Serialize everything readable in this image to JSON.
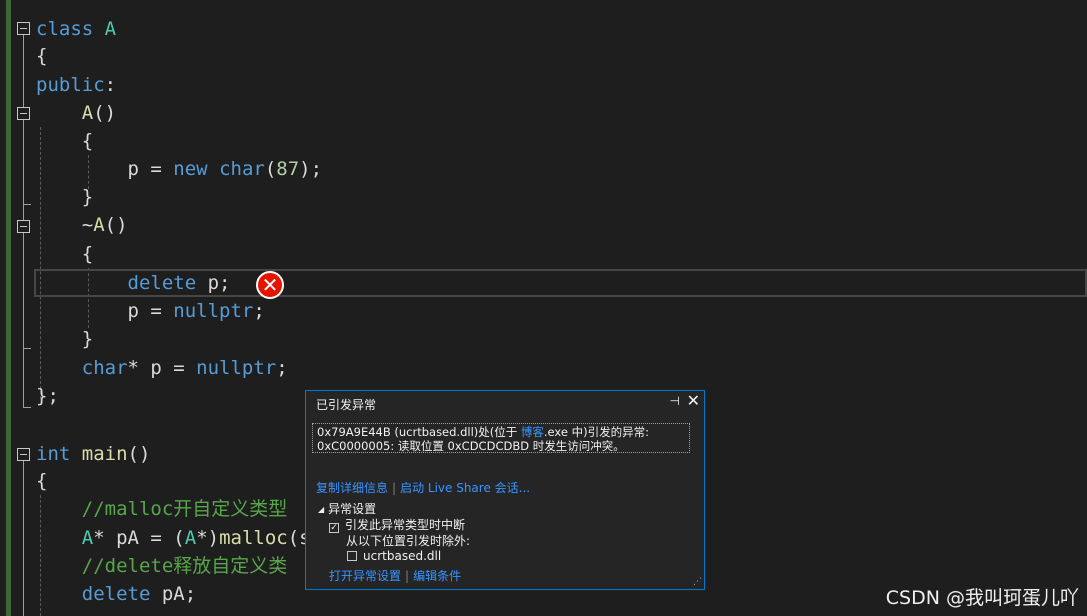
{
  "editor": {
    "lines": [
      {
        "id": "l1",
        "tokens": [
          [
            "kw",
            "class"
          ],
          [
            "id",
            " "
          ],
          [
            "cls",
            "A"
          ]
        ]
      },
      {
        "id": "l2",
        "tokens": [
          [
            "id",
            "{"
          ]
        ]
      },
      {
        "id": "l3",
        "tokens": [
          [
            "kw",
            "public"
          ],
          [
            "id",
            ":"
          ]
        ]
      },
      {
        "id": "l4",
        "tokens": [
          [
            "id",
            "    "
          ],
          [
            "fn",
            "A"
          ],
          [
            "id",
            "()"
          ]
        ]
      },
      {
        "id": "l5",
        "tokens": [
          [
            "id",
            "    {"
          ]
        ]
      },
      {
        "id": "l6",
        "tokens": [
          [
            "id",
            "        p = "
          ],
          [
            "kw",
            "new"
          ],
          [
            "id",
            " "
          ],
          [
            "kw",
            "char"
          ],
          [
            "id",
            "("
          ],
          [
            "num",
            "87"
          ],
          [
            "id",
            ");"
          ]
        ]
      },
      {
        "id": "l7",
        "tokens": [
          [
            "id",
            "    }"
          ]
        ]
      },
      {
        "id": "l8",
        "tokens": [
          [
            "id",
            "    ~"
          ],
          [
            "fn",
            "A"
          ],
          [
            "id",
            "()"
          ]
        ]
      },
      {
        "id": "l9",
        "tokens": [
          [
            "id",
            "    {"
          ]
        ]
      },
      {
        "id": "l10",
        "tokens": [
          [
            "id",
            "        "
          ],
          [
            "kw",
            "delete"
          ],
          [
            "id",
            " p;"
          ]
        ]
      },
      {
        "id": "l11",
        "tokens": [
          [
            "id",
            "        p = "
          ],
          [
            "kw",
            "nullptr"
          ],
          [
            "id",
            ";"
          ]
        ]
      },
      {
        "id": "l12",
        "tokens": [
          [
            "id",
            "    }"
          ]
        ]
      },
      {
        "id": "l13",
        "tokens": [
          [
            "id",
            "    "
          ],
          [
            "kw",
            "char"
          ],
          [
            "id",
            "* p = "
          ],
          [
            "kw",
            "nullptr"
          ],
          [
            "id",
            ";"
          ]
        ]
      },
      {
        "id": "l14",
        "tokens": [
          [
            "id",
            "};"
          ]
        ]
      },
      {
        "id": "l15",
        "tokens": [
          [
            "id",
            ""
          ]
        ]
      },
      {
        "id": "l16",
        "tokens": [
          [
            "kw",
            "int"
          ],
          [
            "id",
            " "
          ],
          [
            "fn",
            "main"
          ],
          [
            "id",
            "()"
          ]
        ]
      },
      {
        "id": "l17",
        "tokens": [
          [
            "id",
            "{"
          ]
        ]
      },
      {
        "id": "l18",
        "tokens": [
          [
            "id",
            "    "
          ],
          [
            "cm",
            "//malloc开自定义类型"
          ]
        ]
      },
      {
        "id": "l19",
        "tokens": [
          [
            "id",
            "    "
          ],
          [
            "cls",
            "A"
          ],
          [
            "id",
            "* pA = ("
          ],
          [
            "cls",
            "A"
          ],
          [
            "id",
            "*)"
          ],
          [
            "fn",
            "malloc"
          ],
          [
            "id",
            "(s"
          ]
        ]
      },
      {
        "id": "l20",
        "tokens": [
          [
            "id",
            "    "
          ],
          [
            "cm",
            "//delete释放自定义类"
          ]
        ]
      },
      {
        "id": "l21",
        "tokens": [
          [
            "id",
            "    "
          ],
          [
            "kw",
            "delete"
          ],
          [
            "id",
            " pA;"
          ]
        ]
      }
    ]
  },
  "exception_popup": {
    "title": "已引发异常",
    "message_line1_a": "0x79A9E44B (ucrtbased.dll)处(位于 ",
    "message_line1_hl": "博客",
    "message_line1_b": ".exe 中)引发的异常:",
    "message_line2": "0xC0000005: 读取位置 0xCDCDCDBD 时发生访问冲突。",
    "copy_details": "复制详细信息",
    "start_live_share": "启动 Live Share 会话...",
    "exception_settings": "异常设置",
    "break_when_thrown": "引发此异常类型时中断",
    "except_when_from": "从以下位置引发时除外:",
    "ucrtbased": "ucrtbased.dll",
    "open_exception_settings": "打开异常设置",
    "edit_conditions": "编辑条件",
    "break_checked": true,
    "ucrtbased_checked": false
  },
  "watermark": "CSDN @我叫珂蛋儿吖"
}
